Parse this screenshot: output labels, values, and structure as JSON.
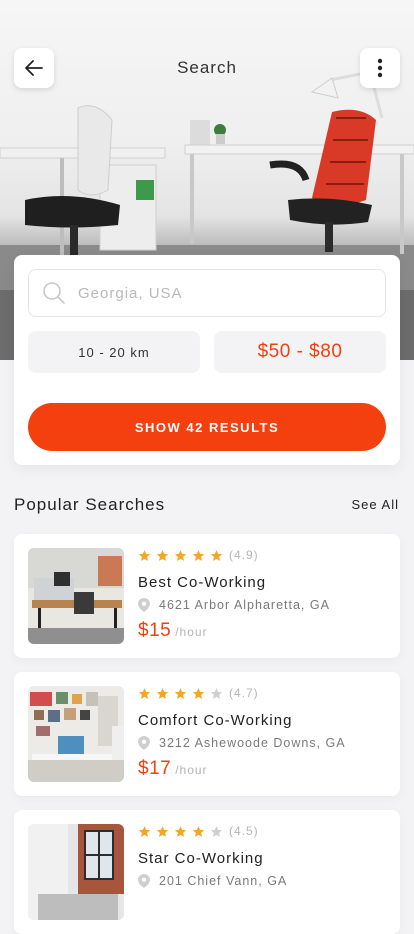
{
  "header": {
    "title": "Search"
  },
  "icons": {
    "back": "arrow-left-icon",
    "menu": "more-vertical-icon",
    "search": "search-icon",
    "location": "map-pin-icon",
    "star": "star-icon"
  },
  "colors": {
    "accent": "#f43f0e",
    "star": "#f5a623",
    "star_empty": "#cfcfcf"
  },
  "search": {
    "placeholder": "Georgia, USA",
    "distance": "10 - 20 km",
    "price_range": "$50 - $80",
    "show_button": "SHOW 42 RESULTS"
  },
  "popular": {
    "title": "Popular Searches",
    "see_all": "See All",
    "items": [
      {
        "stars": 5,
        "rating": "(4.9)",
        "name": "Best Co-Working",
        "address": "4621 Arbor Alpharetta, GA",
        "price": "$15",
        "unit": "/hour"
      },
      {
        "stars": 4,
        "rating": "(4.7)",
        "name": "Comfort Co-Working",
        "address": "3212 Ashewoode Downs, GA",
        "price": "$17",
        "unit": "/hour"
      },
      {
        "stars": 4,
        "rating": "(4.5)",
        "name": "Star Co-Working",
        "address": "201 Chief Vann, GA",
        "price": "",
        "unit": ""
      }
    ]
  }
}
